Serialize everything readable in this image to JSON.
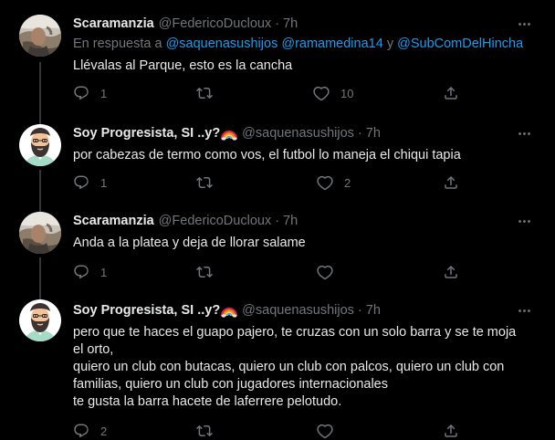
{
  "colors": {
    "background": "#000000",
    "primary_text": "#e7e9ea",
    "secondary_text": "#71767b",
    "link": "#1d9bf0",
    "divider": "#2f3336"
  },
  "icons": {
    "more": "more-dots-icon",
    "reply": "reply-icon",
    "retweet": "retweet-icon",
    "like": "heart-icon",
    "share": "share-icon"
  },
  "tweets": [
    {
      "name": "Scaramanzia",
      "handle": "@FedericoDucloux",
      "dot": "·",
      "time": "7h",
      "reply_prefix": "En respuesta a",
      "reply_mentions": "@saquenasushijos @ramamedina14",
      "reply_and": "y",
      "reply_last": "@SubComDelHincha",
      "text": "Llévalas al Parque, esto es la cancha",
      "replies": "1",
      "retweets": "",
      "likes": "10"
    },
    {
      "name": "Soy Progresista, SI ..y?",
      "handle": "@saquenasushijos",
      "dot": "·",
      "time": "7h",
      "text": "por cabezas de termo como vos, el futbol lo maneja el chiqui tapia",
      "replies": "1",
      "retweets": "",
      "likes": "2"
    },
    {
      "name": "Scaramanzia",
      "handle": "@FedericoDucloux",
      "dot": "·",
      "time": "7h",
      "text": "Anda a la platea y deja de llorar salame",
      "replies": "1",
      "retweets": "",
      "likes": ""
    },
    {
      "name": "Soy Progresista, SI ..y?",
      "handle": "@saquenasushijos",
      "dot": "·",
      "time": "7h",
      "text": "pero que te haces el guapo pajero, te cruzas con un solo barra y se te moja\nel orto,\nquiero un club con butacas, quiero un club con palcos, quiero un club con\nfamilias, quiero un club con jugadores internacionales\nte gusta la barra hacete de laferrere pelotudo.",
      "replies": "2",
      "retweets": "",
      "likes": ""
    }
  ]
}
